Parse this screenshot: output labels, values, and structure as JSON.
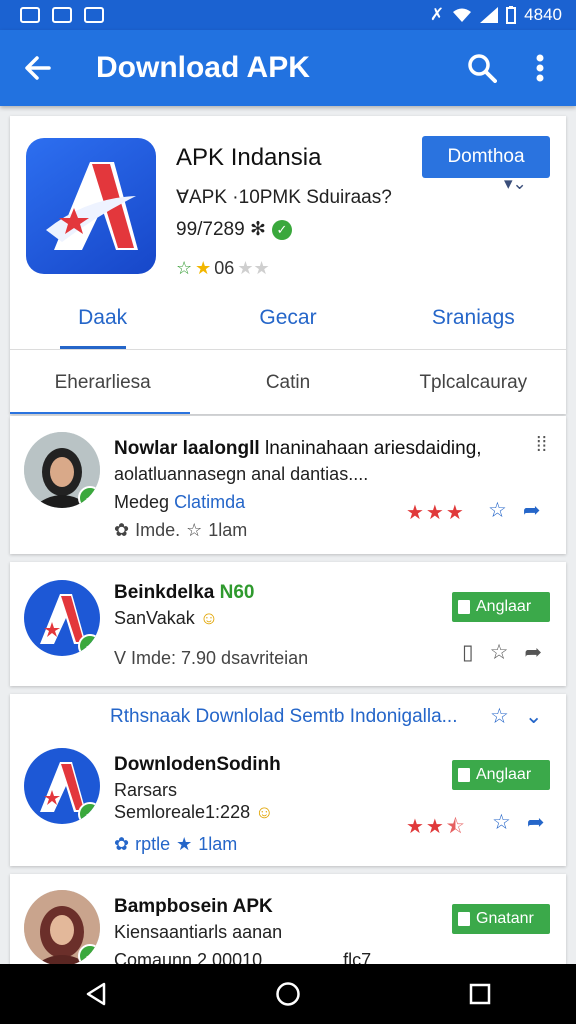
{
  "status": {
    "time": "4840"
  },
  "appbar": {
    "title": "Download APK"
  },
  "app": {
    "name": "APK Indansia",
    "subtitle": "ⱯAPK ·10PMK Sduiraas?",
    "size": "99/7289 ✻",
    "rating": "06",
    "download_label": "Domthoa"
  },
  "tabs": [
    "Daak",
    "Gecar",
    "Sraniags"
  ],
  "subtabs": [
    "Eherarliesa",
    "Catin",
    "Tplcalcauray"
  ],
  "items": [
    {
      "title": "Nowlar laalongll",
      "title_rest": "lnaninahaan ariesdaiding,",
      "line2": "aolatluannasegn anal dantias....",
      "author_a": "Medeg",
      "author_b": "Clatimda",
      "meta_a": "Imde.",
      "meta_b": "1lam"
    },
    {
      "title_a": "Beinkdelka",
      "title_b": "N60",
      "line2": "SanVakak",
      "meta": "V Imde: 7.90 dsavriteian",
      "button": "Anglaar"
    },
    {
      "headline": "Rthsnaak Downlolad Semtb Indonigalla...",
      "title": "DownlodenSodinh",
      "line2": "Rarsars",
      "line3": "Semloreale1:228",
      "meta_a": "rptle",
      "meta_b": "1lam",
      "button": "Anglaar"
    },
    {
      "title": "Bampbosein APK",
      "line2": "Kiensaantiarls aanan",
      "line3": "Comaunn 2 00010",
      "line3_right": "flc7",
      "button": "Gnatanr"
    }
  ]
}
